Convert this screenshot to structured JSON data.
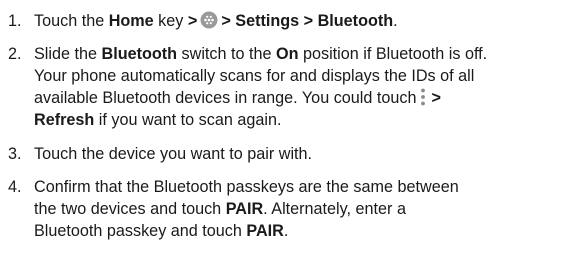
{
  "steps": [
    {
      "number": "1.",
      "t1": "Touch the ",
      "b1": "Home",
      "t2": " key ",
      "b2": ">",
      "b3": "> Settings > Bluetooth",
      "t3": "."
    },
    {
      "number": "2.",
      "t1": "Slide the ",
      "b1": "Bluetooth",
      "t2": " switch to the ",
      "b2": "On",
      "t3": " position if Bluetooth is off.",
      "line2": "Your phone automatically scans for and displays the IDs of all",
      "line3": "available Bluetooth devices in range. You could touch",
      "b3": ">",
      "b4": "Refresh",
      "t4": " if you want to scan again."
    },
    {
      "number": "3.",
      "text": "Touch the device you want to pair with."
    },
    {
      "number": "4.",
      "line1": "Confirm that the Bluetooth passkeys are the same between",
      "line2a": "the two devices and touch ",
      "b1": "PAIR",
      "line2b": ". Alternately, enter a",
      "line3a": "Bluetooth passkey and touch ",
      "b2": "PAIR",
      "line3b": "."
    }
  ],
  "icons": {
    "apps": "apps-icon",
    "more": "more-options-icon"
  }
}
